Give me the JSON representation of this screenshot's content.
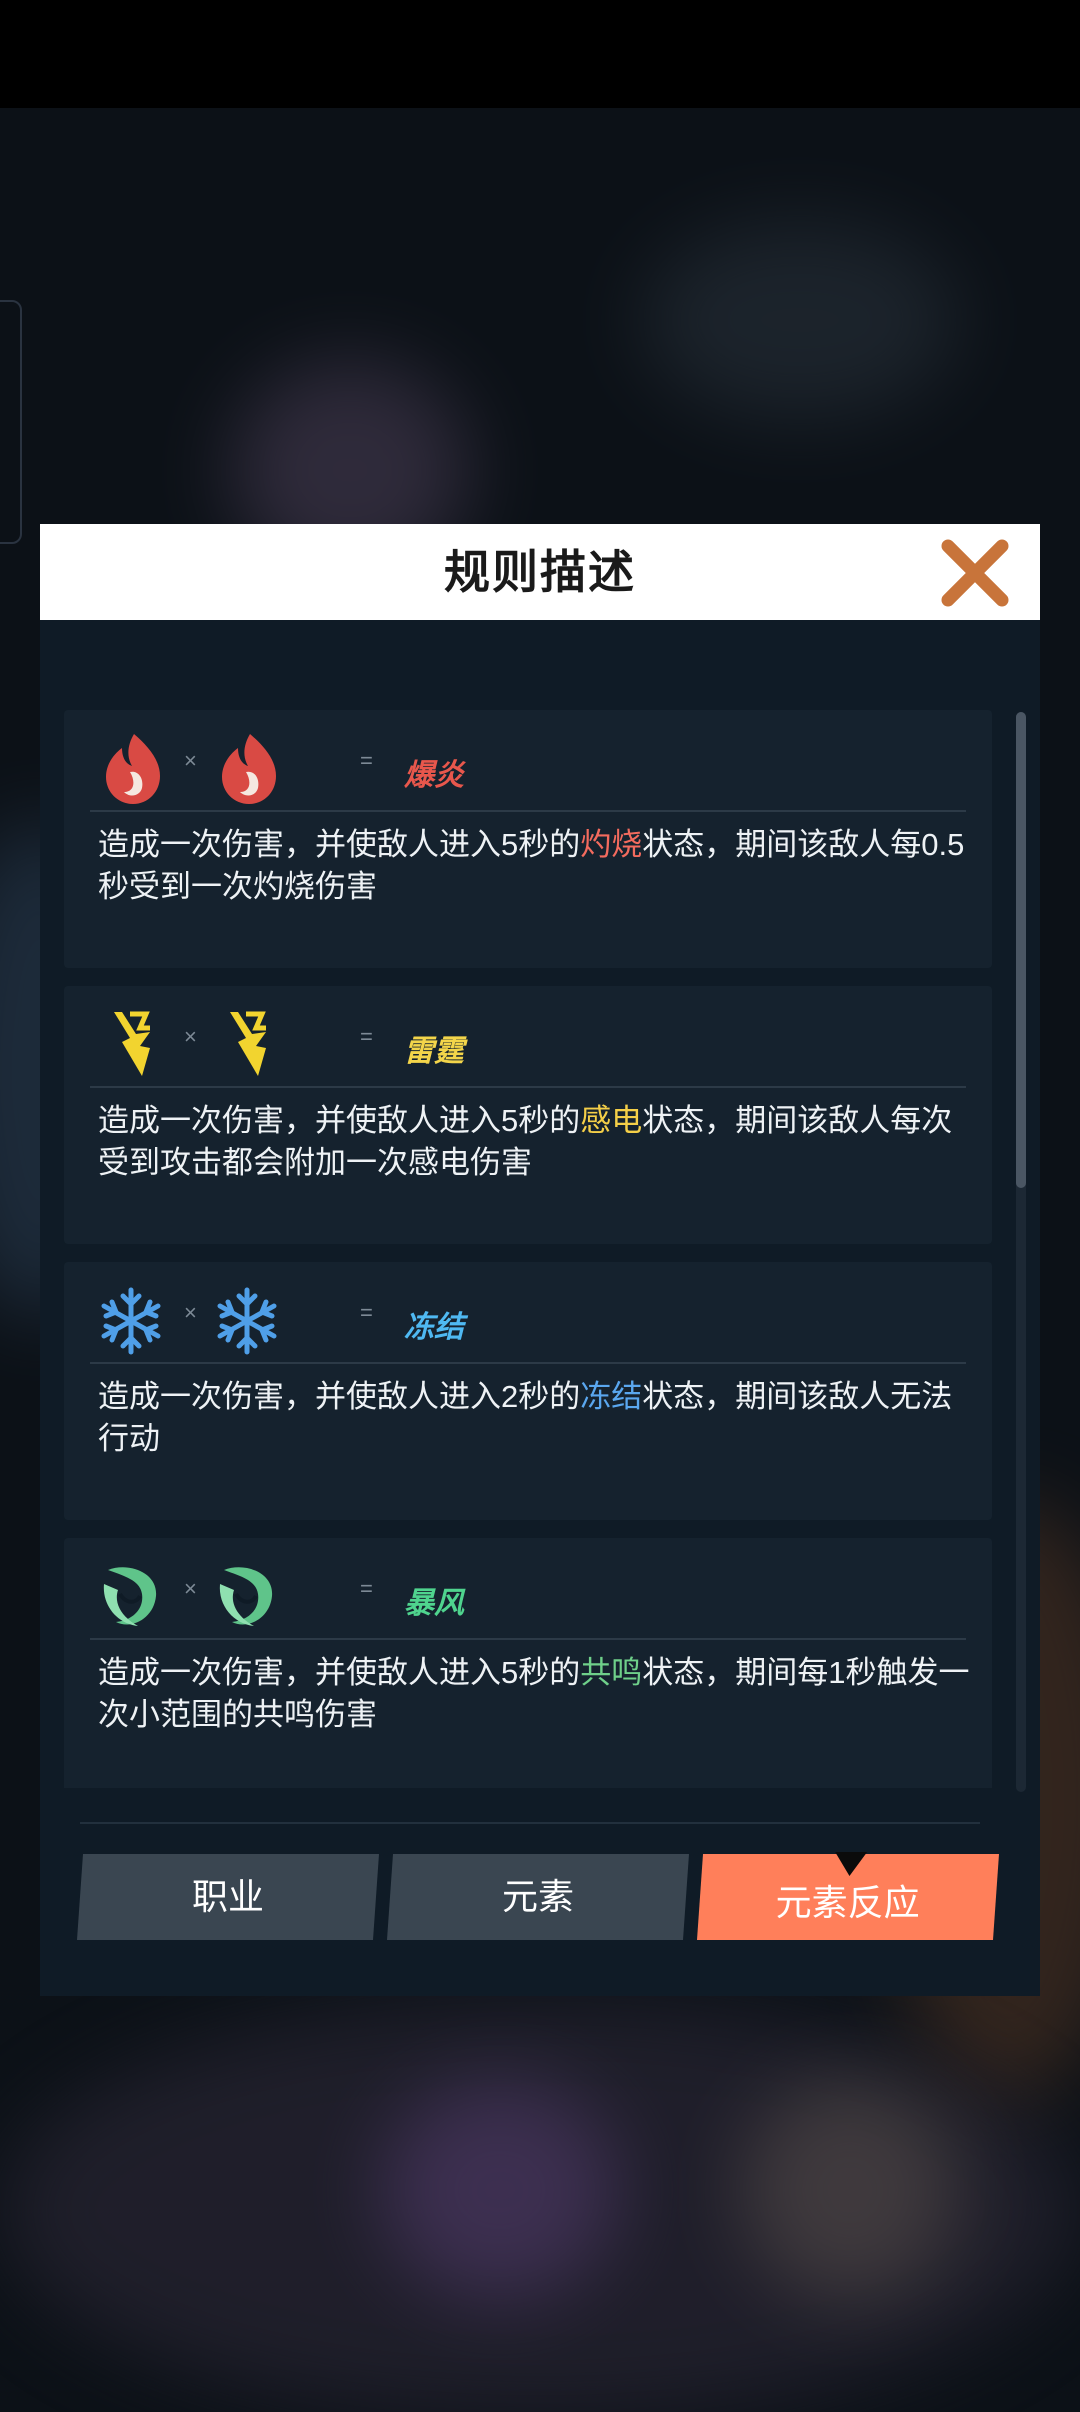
{
  "dialog": {
    "title": "规则描述",
    "close_icon": "close-x-icon"
  },
  "reactions": [
    {
      "element_icon": "fire-icon",
      "operator": "×",
      "equals": "=",
      "result": "爆炎",
      "result_color": "#e8574c",
      "desc_before": "造成一次伤害，并使敌人进入5秒的",
      "highlight": "灼烧",
      "highlight_color": "#f36b5e",
      "desc_after": "状态，期间该敌人每0.5秒受到一次灼烧伤害"
    },
    {
      "element_icon": "lightning-icon",
      "operator": "×",
      "equals": "=",
      "result": "雷霆",
      "result_color": "#f3d54a",
      "desc_before": "造成一次伤害，并使敌人进入5秒的",
      "highlight": "感电",
      "highlight_color": "#f4cf48",
      "desc_after": "状态，期间该敌人每次受到攻击都会附加一次感电伤害"
    },
    {
      "element_icon": "snowflake-icon",
      "operator": "×",
      "equals": "=",
      "result": "冻结",
      "result_color": "#4fb9f2",
      "desc_before": "造成一次伤害，并使敌人进入2秒的",
      "highlight": "冻结",
      "highlight_color": "#5aa7ef",
      "desc_after": "状态，期间该敌人无法行动"
    },
    {
      "element_icon": "wind-swirl-icon",
      "operator": "×",
      "equals": "=",
      "result": "暴风",
      "result_color": "#4fd48e",
      "desc_before": "造成一次伤害，并使敌人进入5秒的",
      "highlight": "共鸣",
      "highlight_color": "#6fd08a",
      "desc_after": "状态，期间每1秒触发一次小范围的共鸣伤害"
    }
  ],
  "tabs": [
    {
      "label": "职业",
      "active": false
    },
    {
      "label": "元素",
      "active": false
    },
    {
      "label": "元素反应",
      "active": true
    }
  ],
  "colors": {
    "accent": "#ff7f5a",
    "close": "#c8743a",
    "panel": "#0f1b26",
    "card": "#15222e"
  }
}
